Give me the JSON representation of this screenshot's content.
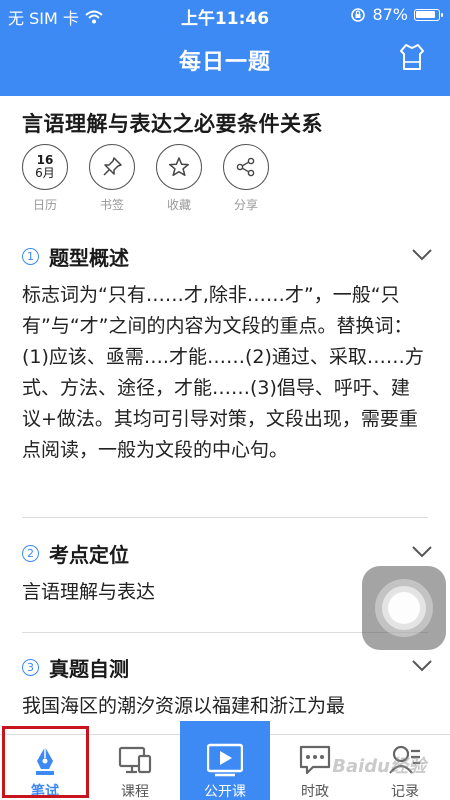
{
  "status": {
    "carrier": "无 SIM 卡",
    "time": "上午11:46",
    "battery": "87%"
  },
  "nav": {
    "title": "每日一题",
    "right_icon": "shirt-icon"
  },
  "article": {
    "title": "言语理解与表达之必要条件关系",
    "actions": [
      {
        "label": "日历",
        "icon": "calendar-icon",
        "date_day": "16",
        "date_month": "6月"
      },
      {
        "label": "书签",
        "icon": "pin-icon"
      },
      {
        "label": "收藏",
        "icon": "star-icon"
      },
      {
        "label": "分享",
        "icon": "share-icon"
      }
    ],
    "sections": [
      {
        "num": "1",
        "title": "题型概述",
        "body": "标志词为“只有……才,除非……才”，一般“只有”与“才”之间的内容为文段的重点。替换词：(1)应该、亟需….才能……(2)通过、采取……方式、方法、途径，才能……(3)倡导、呼吁、建议+做法。其均可引导对策，文段出现，需要重点阅读，一般为文段的中心句。"
      },
      {
        "num": "2",
        "title": "考点定位",
        "body": "言语理解与表达"
      },
      {
        "num": "3",
        "title": "真题自测",
        "body": "我国海区的潮汐资源以福建和浙江为最"
      }
    ]
  },
  "tabbar": {
    "tabs": [
      {
        "label": "笔试",
        "icon": "pen-icon",
        "active": true
      },
      {
        "label": "课程",
        "icon": "monitor-icon"
      },
      {
        "label": "公开课",
        "icon": "play-icon"
      },
      {
        "label": "时政",
        "icon": "chat-icon"
      },
      {
        "label": "记录",
        "icon": "record-icon"
      }
    ]
  },
  "watermark": "Baidu经验",
  "colors": {
    "primary": "#3d8af4",
    "highlight": "#c8151d"
  }
}
